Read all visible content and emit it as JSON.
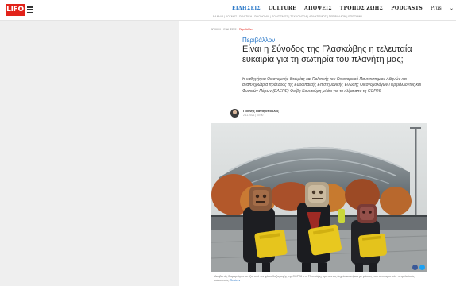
{
  "header": {
    "logo_text": "LIFO",
    "nav": [
      "ΕΙΔΗΣΕΙΣ",
      "CULTURE",
      "ΑΠΟΨΕΙΣ",
      "ΤΡΟΠΟΣ ΖΩΗΣ",
      "PODCASTS"
    ],
    "nav_active_index": 0,
    "plus_label": "Plus",
    "subnav": "ΕΛΛΑΔΑ | ΚΟΣΜΟΣ | ΠΟΛΙΤΙΚΗ | ΟΙΚΟΝΟΜΙΑ | ΠΟΛΙΤΙΣΜΟΣ | ΤΕΧΝΟΛΟΓΙΑ | ΑΘΛΗΤΙΣΜΟΣ | ΠΕΡΙΒΑΛΛΟΝ | ΕΠΙΣΤΗΜΗ"
  },
  "breadcrumb": {
    "home": "ΑΡΧΙΚΗ",
    "section": "ΕΙΔΗΣΕΙΣ",
    "current": "Περιβάλλον"
  },
  "article": {
    "category": "Περιβάλλον",
    "title": "Είναι η Σύνοδος της Γλασκώβης η τελευταία ευκαιρία για τη σωτηρία του πλανήτη μας;",
    "lead": "Η καθηγήτρια Οικονομικής Θεωρίας και Πολιτικής του Οικονομικού Πανεπιστημίου Αθηνών και αναπληρώτρια πρόεδρος της Ευρωπαϊκής Επιστημονικής Ένωσης Οικονομολόγων Περιβάλλοντος και Φυσικών Πόρων (EAERE) Φοίβη Κουντούρη μιλάει για το κλίμα από τη COP26",
    "author": "Γιάννης Παναγόπουλος",
    "date": "2.11.2021 | 00:00",
    "caption": "Ακτιβιστές διαμαρτύρονται έξω από τον χώρο διεξαγωγής της COP26 στη Γλασκώβη, κρατώντας δοχεία καυσίμων με μάσκες που αναπαριστούν πετρελαϊκούς κολοσσούς.",
    "caption_more": "Reuters"
  },
  "colors": {
    "brand_red": "#e2231a",
    "link_blue": "#2a78c8"
  },
  "icons": {
    "menu": "hamburger-icon",
    "share_facebook": "facebook-icon",
    "share_twitter": "twitter-icon"
  }
}
